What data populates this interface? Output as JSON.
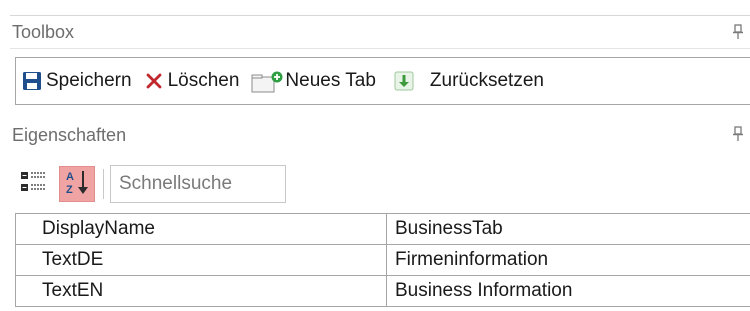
{
  "toolbox": {
    "title": "Toolbox",
    "save_label": "Speichern",
    "delete_label": "Löschen",
    "new_tab_label": "Neues Tab",
    "reset_label": "Zurücksetzen"
  },
  "properties": {
    "title": "Eigenschaften",
    "search_placeholder": "Schnellsuche",
    "rows": [
      {
        "name": "DisplayName",
        "value": "BusinessTab"
      },
      {
        "name": "TextDE",
        "value": "Firmeninformation"
      },
      {
        "name": "TextEN",
        "value": "Business Information"
      }
    ]
  },
  "colors": {
    "save_icon": "#1f4e8c",
    "delete_icon": "#c0282d",
    "reset_icon": "#3c9a3c",
    "sort_active_bg": "#f0a3a3"
  },
  "icons": {
    "toolbox_pin": "pin-icon",
    "props_pin": "pin-icon",
    "save": "floppy-disk-icon",
    "delete": "x-icon",
    "new_tab": "new-tab-icon",
    "reset": "reset-arrow-icon",
    "categorized": "categorized-view-icon",
    "alphabetical": "sort-az-icon"
  }
}
